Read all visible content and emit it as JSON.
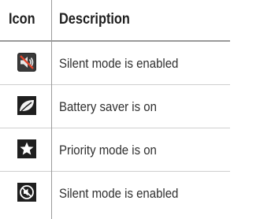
{
  "table": {
    "headers": {
      "icon": "Icon",
      "description": "Description"
    },
    "rows": [
      {
        "icon": "speaker-muted-icon",
        "description": "Silent mode is enabled"
      },
      {
        "icon": "leaf-icon",
        "description": "Battery saver is on"
      },
      {
        "icon": "star-icon",
        "description": "Priority mode is on"
      },
      {
        "icon": "do-not-disturb-icon",
        "description": "Silent mode is enabled"
      }
    ]
  },
  "colors": {
    "icon_background": "#1f1f1f",
    "mute_accent": "#e0452c",
    "rule": "#9a9a9a"
  }
}
